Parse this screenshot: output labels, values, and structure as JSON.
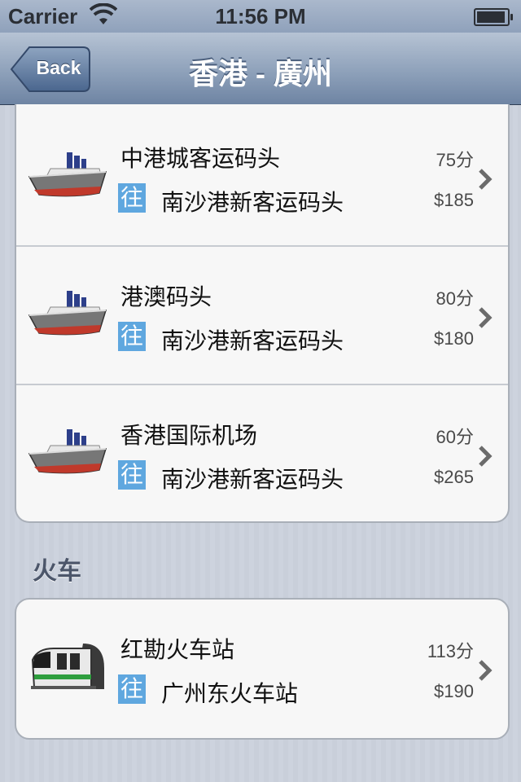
{
  "status": {
    "carrier": "Carrier",
    "time": "11:56 PM"
  },
  "nav": {
    "back_label": "Back",
    "title": "香港 - 廣州"
  },
  "ferry_routes": [
    {
      "from": "中港城客运码头",
      "marker": "往",
      "to": "南沙港新客运码头",
      "duration": "75分",
      "price": "$185",
      "icon": "ship-icon"
    },
    {
      "from": "港澳码头",
      "marker": "往",
      "to": "南沙港新客运码头",
      "duration": "80分",
      "price": "$180",
      "icon": "ship-icon"
    },
    {
      "from": "香港国际机场",
      "marker": "往",
      "to": "南沙港新客运码头",
      "duration": "60分",
      "price": "$265",
      "icon": "ship-icon"
    }
  ],
  "train_section": {
    "header": "火车",
    "routes": [
      {
        "from": "红勘火车站",
        "marker": "往",
        "to": "广州东火车站",
        "duration": "113分",
        "price": "$190",
        "icon": "train-icon"
      }
    ]
  },
  "colors": {
    "marker_bg": "#5fa7df",
    "nav_bar": "#8ea1ba"
  }
}
